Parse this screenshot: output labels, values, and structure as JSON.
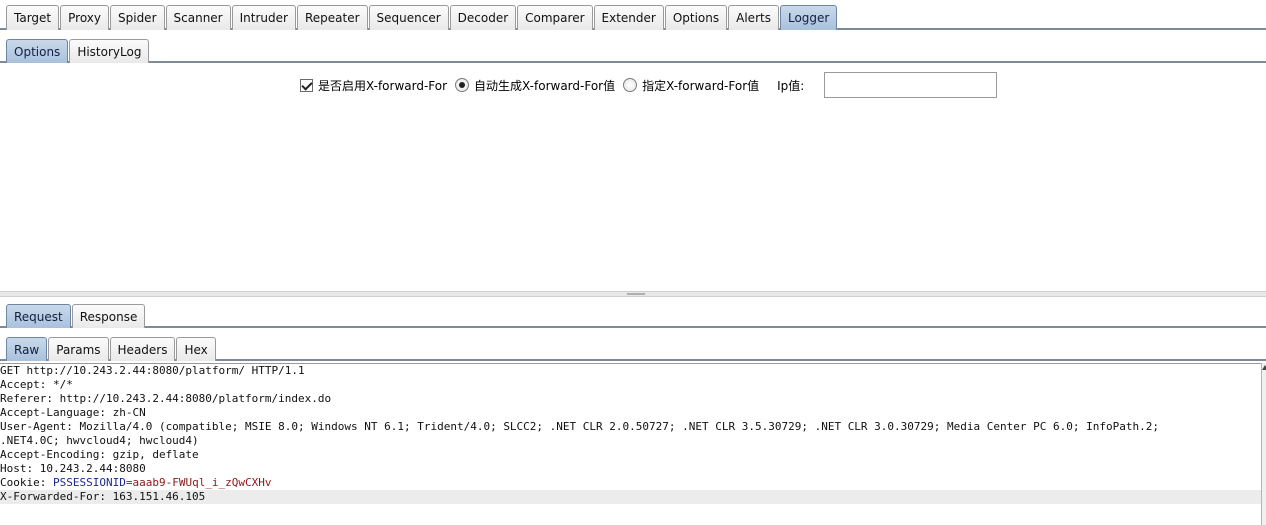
{
  "main_tabs": [
    "Target",
    "Proxy",
    "Spider",
    "Scanner",
    "Intruder",
    "Repeater",
    "Sequencer",
    "Decoder",
    "Comparer",
    "Extender",
    "Options",
    "Alerts",
    "Logger"
  ],
  "main_tab_active": "Logger",
  "sub_tabs": [
    "Options",
    "HistoryLog"
  ],
  "sub_tab_active": "Options",
  "options": {
    "enable_label": "是否启用X-forward-For",
    "enable_checked": true,
    "auto_label": "自动生成X-forward-For值",
    "auto_selected": true,
    "specify_label": "指定X-forward-For值",
    "specify_selected": false,
    "ip_label": "Ip值:",
    "ip_value": ""
  },
  "message_tabs": [
    "Request",
    "Response"
  ],
  "message_tab_active": "Request",
  "view_tabs": [
    "Raw",
    "Params",
    "Headers",
    "Hex"
  ],
  "view_tab_active": "Raw",
  "request_lines": [
    "GET http://10.243.2.44:8080/platform/ HTTP/1.1",
    "Accept: */*",
    "Referer: http://10.243.2.44:8080/platform/index.do",
    "Accept-Language: zh-CN",
    "User-Agent: Mozilla/4.0 (compatible; MSIE 8.0; Windows NT 6.1; Trident/4.0; SLCC2; .NET CLR 2.0.50727; .NET CLR 3.5.30729; .NET CLR 3.0.30729; Media Center PC 6.0; InfoPath.2;",
    ".NET4.0C; hwvcloud4; hwcloud4)",
    "Accept-Encoding: gzip, deflate",
    "Host: 10.243.2.44:8080"
  ],
  "cookie": {
    "prefix": "Cookie: ",
    "name": "PSSESSIONID",
    "value": "=aaab9-FWUql_i_zQwCXHv"
  },
  "forwarded_line": "X-Forwarded-For: 163.151.46.105"
}
